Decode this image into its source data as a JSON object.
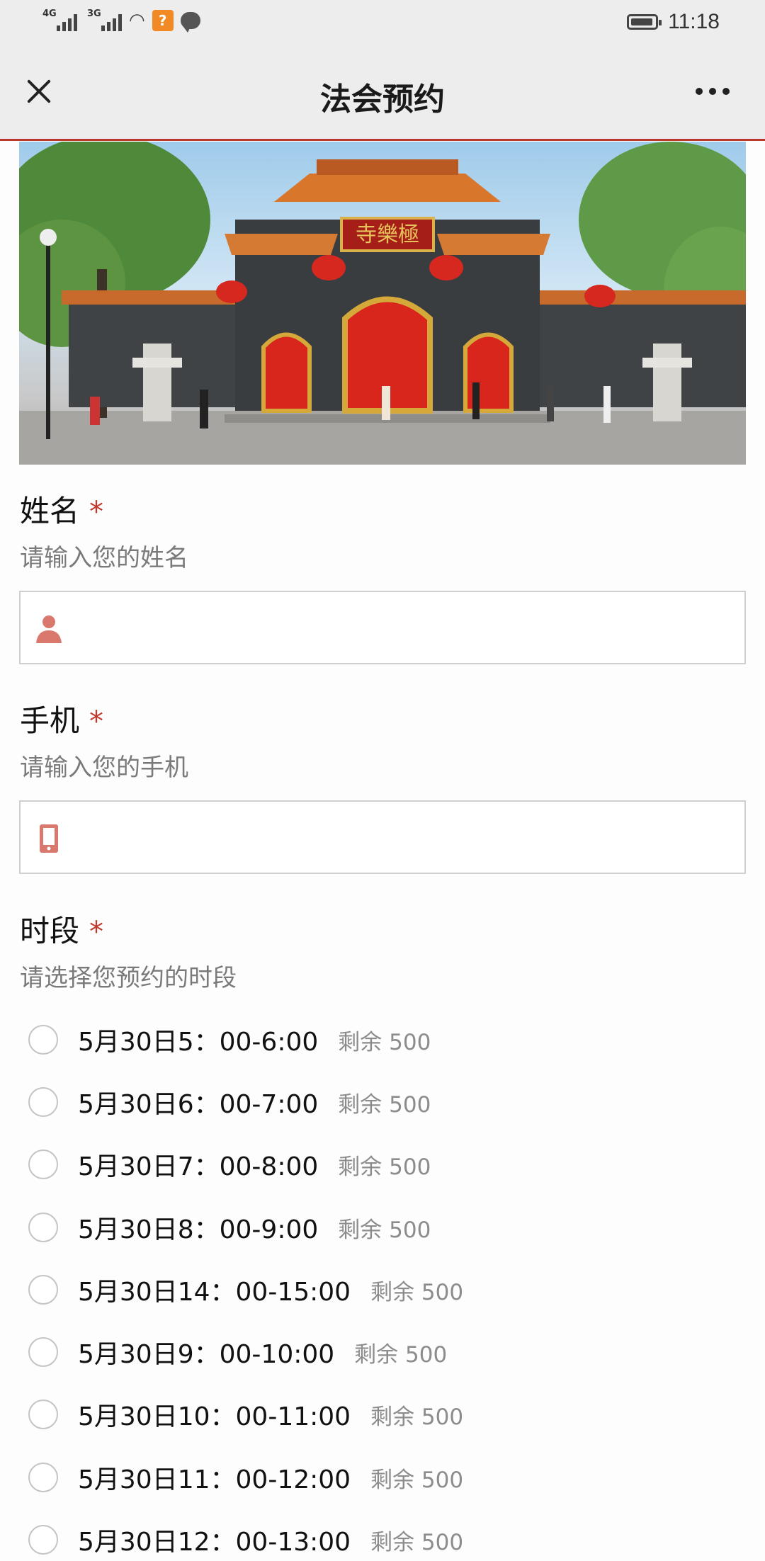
{
  "status_bar": {
    "net1": "4G",
    "net2": "3G",
    "time": "11:18"
  },
  "nav": {
    "title": "法会预约"
  },
  "form": {
    "name": {
      "label": "姓名",
      "required_mark": "*",
      "hint": "请输入您的姓名",
      "icon": "person-icon",
      "value": ""
    },
    "phone": {
      "label": "手机",
      "required_mark": "*",
      "hint": "请输入您的手机",
      "icon": "phone-icon",
      "value": ""
    },
    "slot": {
      "label": "时段",
      "required_mark": "*",
      "hint": "请选择您预约的时段",
      "options": [
        {
          "label": "5月30日5：00-6:00",
          "remain": "剩余 500"
        },
        {
          "label": "5月30日6：00-7:00",
          "remain": "剩余 500"
        },
        {
          "label": "5月30日7：00-8:00",
          "remain": "剩余 500"
        },
        {
          "label": "5月30日8：00-9:00",
          "remain": "剩余 500"
        },
        {
          "label": "5月30日14：00-15:00",
          "remain": "剩余 500"
        },
        {
          "label": "5月30日9：00-10:00",
          "remain": "剩余 500"
        },
        {
          "label": "5月30日10：00-11:00",
          "remain": "剩余 500"
        },
        {
          "label": "5月30日11：00-12:00",
          "remain": "剩余 500"
        },
        {
          "label": "5月30日12：00-13:00",
          "remain": "剩余 500"
        }
      ]
    }
  },
  "hero": {
    "plaque_text": "寺樂極"
  },
  "colors": {
    "accent": "#b9392e",
    "required": "#c0392b",
    "icon": "#d9796e"
  }
}
